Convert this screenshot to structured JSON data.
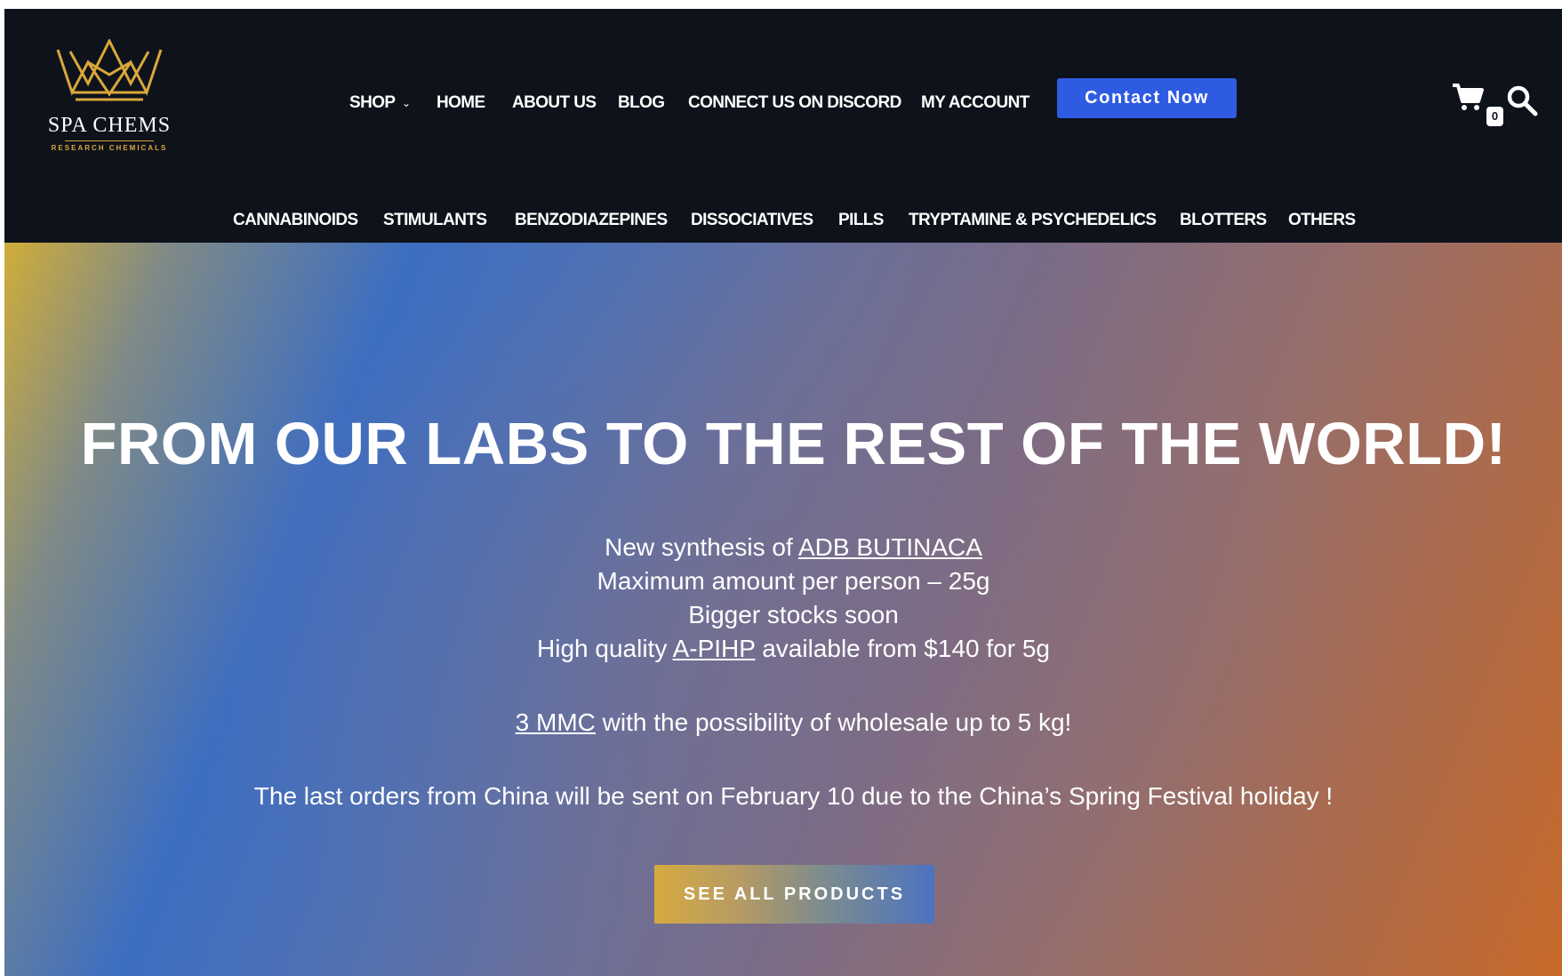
{
  "logo": {
    "name": "SPA CHEMS",
    "tagline": "RESEARCH CHEMICALS",
    "brand_color": "#d9a73a"
  },
  "nav": {
    "items": [
      {
        "label": "SHOP",
        "has_dropdown": true
      },
      {
        "label": "HOME"
      },
      {
        "label": "ABOUT US"
      },
      {
        "label": "BLOG"
      },
      {
        "label": "CONNECT US ON DISCORD"
      },
      {
        "label": "MY ACCOUNT"
      }
    ],
    "contact_label": "Contact Now",
    "contact_color": "#2f5be3",
    "cart_icon": "cart-icon",
    "cart_count": "0",
    "search_icon": "search-icon"
  },
  "categories": [
    "CANNABINOIDS",
    "STIMULANTS",
    "BENZODIAZEPINES",
    "DISSOCIATIVES",
    "PILLS",
    "TRYPTAMINE & PSYCHEDELICS",
    "BLOTTERS",
    "OTHERS"
  ],
  "hero": {
    "title": "FROM OUR LABS TO THE REST OF THE WORLD!",
    "line1_pre": "New synthesis of ",
    "line1_link": "ADB BUTINACA",
    "line2": "Maximum amount per person – 25g",
    "line3": "Bigger stocks soon",
    "line4_pre": "High quality ",
    "line4_link": "A-PIHP",
    "line4_post": " available from $140 for 5g",
    "line5_link": "3 MMC",
    "line5_post": " with the possibility of wholesale up to 5 kg!",
    "line6": "The last orders from China will be sent on February 10 due to the China’s Spring Festival holiday !",
    "cta_label": "SEE ALL PRODUCTS"
  }
}
